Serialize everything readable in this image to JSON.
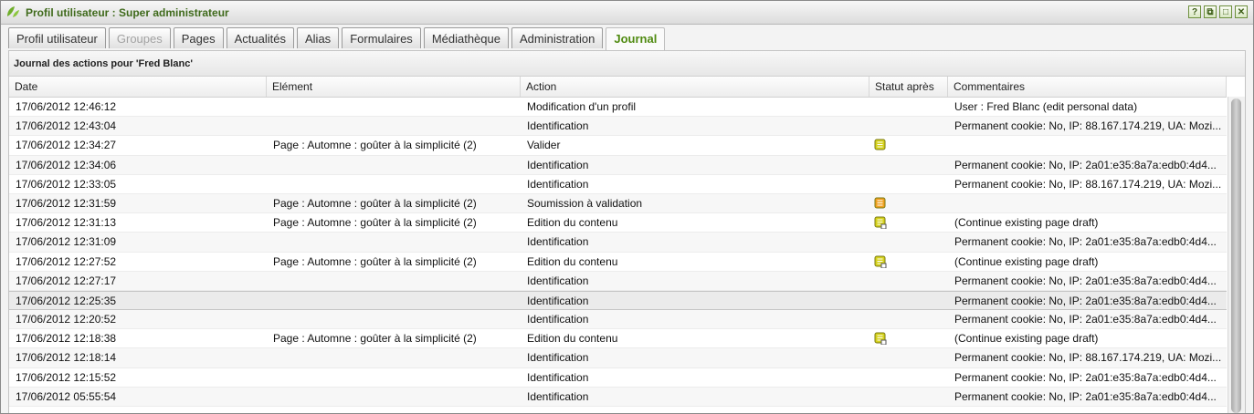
{
  "window": {
    "title": "Profil utilisateur : Super administrateur",
    "controls": [
      "?",
      "⧉",
      "□",
      "✕"
    ]
  },
  "tabs": [
    {
      "label": "Profil utilisateur",
      "state": "normal"
    },
    {
      "label": "Groupes",
      "state": "disabled"
    },
    {
      "label": "Pages",
      "state": "normal"
    },
    {
      "label": "Actualités",
      "state": "normal"
    },
    {
      "label": "Alias",
      "state": "normal"
    },
    {
      "label": "Formulaires",
      "state": "normal"
    },
    {
      "label": "Médiathèque",
      "state": "normal"
    },
    {
      "label": "Administration",
      "state": "normal"
    },
    {
      "label": "Journal",
      "state": "active"
    }
  ],
  "panel": {
    "title": "Journal des actions pour 'Fred Blanc'"
  },
  "columns": {
    "date": "Date",
    "element": "Elément",
    "action": "Action",
    "status": "Statut après",
    "comments": "Commentaires"
  },
  "colors": {
    "accent": "#4f8a10",
    "status_published": "#d6d21c",
    "status_pending": "#f0a020"
  },
  "rows": [
    {
      "date": "17/06/2012 12:46:12",
      "element": "",
      "action": "Modification d'un profil",
      "status": "",
      "comments": "User : Fred Blanc (edit personal data)"
    },
    {
      "date": "17/06/2012 12:43:04",
      "element": "",
      "action": "Identification",
      "status": "",
      "comments": "Permanent cookie: No, IP: 88.167.174.219, UA: Mozi..."
    },
    {
      "date": "17/06/2012 12:34:27",
      "element": "Page : Automne : goûter à la simplicité (2)",
      "action": "Valider",
      "status": "published-icon",
      "comments": ""
    },
    {
      "date": "17/06/2012 12:34:06",
      "element": "",
      "action": "Identification",
      "status": "",
      "comments": "Permanent cookie: No, IP: 2a01:e35:8a7a:edb0:4d4..."
    },
    {
      "date": "17/06/2012 12:33:05",
      "element": "",
      "action": "Identification",
      "status": "",
      "comments": "Permanent cookie: No, IP: 88.167.174.219, UA: Mozi..."
    },
    {
      "date": "17/06/2012 12:31:59",
      "element": "Page : Automne : goûter à la simplicité (2)",
      "action": "Soumission à validation",
      "status": "pending-icon",
      "comments": ""
    },
    {
      "date": "17/06/2012 12:31:13",
      "element": "Page : Automne : goûter à la simplicité (2)",
      "action": "Edition du contenu",
      "status": "draft-icon",
      "comments": "(Continue existing page draft)"
    },
    {
      "date": "17/06/2012 12:31:09",
      "element": "",
      "action": "Identification",
      "status": "",
      "comments": "Permanent cookie: No, IP: 2a01:e35:8a7a:edb0:4d4..."
    },
    {
      "date": "17/06/2012 12:27:52",
      "element": "Page : Automne : goûter à la simplicité (2)",
      "action": "Edition du contenu",
      "status": "draft-icon",
      "comments": "(Continue existing page draft)"
    },
    {
      "date": "17/06/2012 12:27:17",
      "element": "",
      "action": "Identification",
      "status": "",
      "comments": "Permanent cookie: No, IP: 2a01:e35:8a7a:edb0:4d4..."
    },
    {
      "date": "17/06/2012 12:25:35",
      "element": "",
      "action": "Identification",
      "status": "",
      "comments": "Permanent cookie: No, IP: 2a01:e35:8a7a:edb0:4d4...",
      "selected": true
    },
    {
      "date": "17/06/2012 12:20:52",
      "element": "",
      "action": "Identification",
      "status": "",
      "comments": "Permanent cookie: No, IP: 2a01:e35:8a7a:edb0:4d4..."
    },
    {
      "date": "17/06/2012 12:18:38",
      "element": "Page : Automne : goûter à la simplicité (2)",
      "action": "Edition du contenu",
      "status": "draft-icon",
      "comments": "(Continue existing page draft)"
    },
    {
      "date": "17/06/2012 12:18:14",
      "element": "",
      "action": "Identification",
      "status": "",
      "comments": "Permanent cookie: No, IP: 88.167.174.219, UA: Mozi..."
    },
    {
      "date": "17/06/2012 12:15:52",
      "element": "",
      "action": "Identification",
      "status": "",
      "comments": "Permanent cookie: No, IP: 2a01:e35:8a7a:edb0:4d4..."
    },
    {
      "date": "17/06/2012 05:55:54",
      "element": "",
      "action": "Identification",
      "status": "",
      "comments": "Permanent cookie: No, IP: 2a01:e35:8a7a:edb0:4d4..."
    }
  ]
}
